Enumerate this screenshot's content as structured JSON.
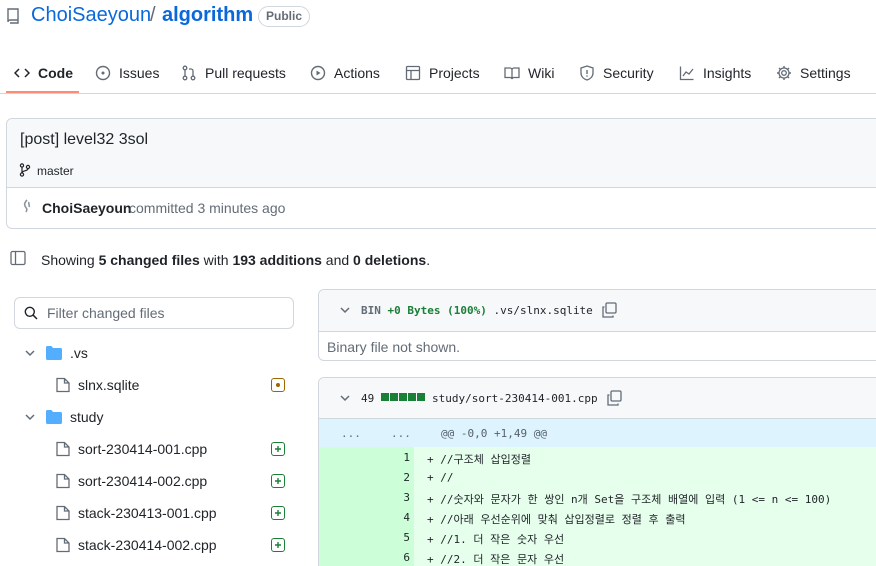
{
  "repo": {
    "owner": "ChoiSaeyoun",
    "separator": "/",
    "name": "algorithm",
    "visibility": "Public"
  },
  "tabs": [
    {
      "label": "Code",
      "icon": "code-icon",
      "selected": true
    },
    {
      "label": "Issues",
      "icon": "issue-icon"
    },
    {
      "label": "Pull requests",
      "icon": "pull-request-icon"
    },
    {
      "label": "Actions",
      "icon": "play-icon"
    },
    {
      "label": "Projects",
      "icon": "table-icon"
    },
    {
      "label": "Wiki",
      "icon": "book-icon"
    },
    {
      "label": "Security",
      "icon": "shield-icon"
    },
    {
      "label": "Insights",
      "icon": "graph-icon"
    },
    {
      "label": "Settings",
      "icon": "gear-icon"
    }
  ],
  "commit": {
    "title": "[post] level32 3sol",
    "branch": "master",
    "author": "ChoiSaeyoun",
    "meta": "committed 3 minutes ago"
  },
  "summary": {
    "prefix": "Showing ",
    "files": "5 changed files",
    "with": " with ",
    "additions": "193 additions",
    "and": " and ",
    "deletions": "0 deletions",
    "end": "."
  },
  "file_tree": {
    "filter_placeholder": "Filter changed files",
    "folders": [
      {
        "name": ".vs",
        "files": [
          {
            "name": "slnx.sqlite",
            "status": "modified"
          }
        ]
      },
      {
        "name": "study",
        "files": [
          {
            "name": "sort-230414-001.cpp",
            "status": "added"
          },
          {
            "name": "sort-230414-002.cpp",
            "status": "added"
          },
          {
            "name": "stack-230413-001.cpp",
            "status": "added"
          },
          {
            "name": "stack-230414-002.cpp",
            "status": "added"
          }
        ]
      }
    ]
  },
  "diff_binary": {
    "stat": "BIN",
    "change": "+0 Bytes (100%)",
    "path": ".vs/slnx.sqlite",
    "body": "Binary file not shown."
  },
  "diff_code": {
    "count": "49",
    "path": "study/sort-230414-001.cpp",
    "hunk_left": "...",
    "hunk_right": "...",
    "hunk": "@@ -0,0 +1,49 @@",
    "lines": [
      {
        "n": "1",
        "text": "+ //구조체 삽입정렬"
      },
      {
        "n": "2",
        "text": "+ //"
      },
      {
        "n": "3",
        "text": "+ //숫자와 문자가 한 쌍인 n개 Set을 구조체 배열에 입력 (1 <= n <= 100)"
      },
      {
        "n": "4",
        "text": "+ //아래 우선순위에 맞춰 삽입정렬로 정렬 후 출력"
      },
      {
        "n": "5",
        "text": "+ //1. 더 작은 숫자 우선"
      },
      {
        "n": "6",
        "text": "+ //2. 더 작은 문자 우선"
      }
    ]
  },
  "colors": {
    "link": "#0969da",
    "added": "#1a7f37",
    "modified": "#9a6700",
    "tab_underline": "#fd8c73",
    "folder": "#54aeff"
  }
}
